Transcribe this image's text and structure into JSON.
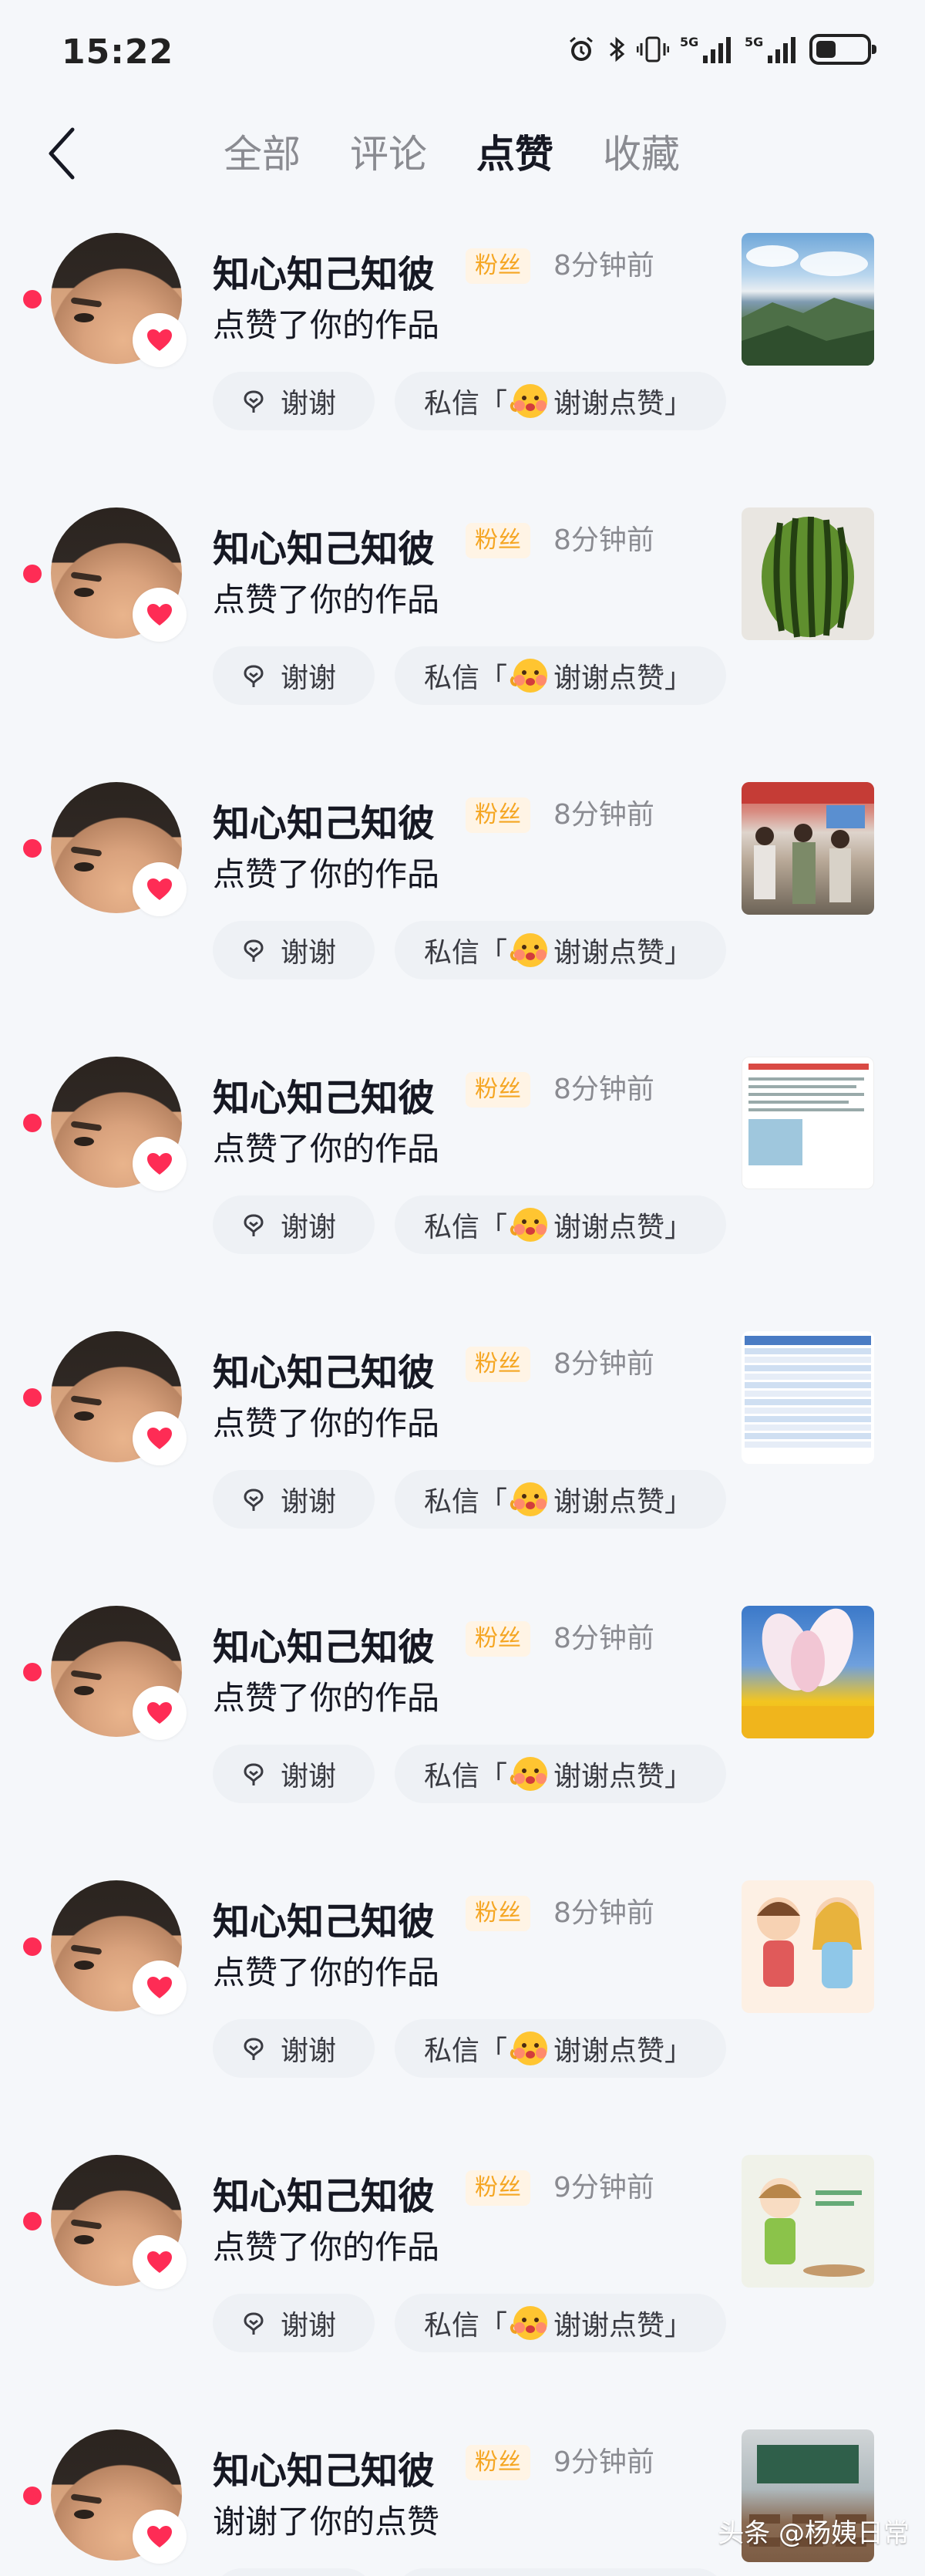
{
  "status": {
    "time": "15:22",
    "network": "5G",
    "battery_level": 0.4
  },
  "nav": {
    "tabs": [
      {
        "label": "全部",
        "active": false
      },
      {
        "label": "评论",
        "active": false
      },
      {
        "label": "点赞",
        "active": true
      },
      {
        "label": "收藏",
        "active": false
      }
    ]
  },
  "labels": {
    "thanks": "谢谢",
    "dm_prefix": "私信「",
    "dm_text": "谢谢点赞」"
  },
  "items": [
    {
      "name": "知心知己知彼",
      "badge": "粉丝",
      "time": "8分钟前",
      "action": "点赞了你的作品",
      "thumb": "mountain-landscape"
    },
    {
      "name": "知心知己知彼",
      "badge": "粉丝",
      "time": "8分钟前",
      "action": "点赞了你的作品",
      "thumb": "watermelon"
    },
    {
      "name": "知心知己知彼",
      "badge": "粉丝",
      "time": "8分钟前",
      "action": "点赞了你的作品",
      "thumb": "crowd-in-room"
    },
    {
      "name": "知心知己知彼",
      "badge": "粉丝",
      "time": "8分钟前",
      "action": "点赞了你的作品",
      "thumb": "text-document"
    },
    {
      "name": "知心知己知彼",
      "badge": "粉丝",
      "time": "8分钟前",
      "action": "点赞了你的作品",
      "thumb": "data-table"
    },
    {
      "name": "知心知己知彼",
      "badge": "粉丝",
      "time": "8分钟前",
      "action": "点赞了你的作品",
      "thumb": "flower"
    },
    {
      "name": "知心知己知彼",
      "badge": "粉丝",
      "time": "8分钟前",
      "action": "点赞了你的作品",
      "thumb": "cartoon-kids"
    },
    {
      "name": "知心知己知彼",
      "badge": "粉丝",
      "time": "9分钟前",
      "action": "点赞了你的作品",
      "thumb": "cartoon-girl"
    },
    {
      "name": "知心知己知彼",
      "badge": "粉丝",
      "time": "9分钟前",
      "action": "谢谢了你的点赞",
      "thumb": "classroom"
    }
  ],
  "watermark": "头条 @杨姨日常",
  "colors": {
    "accent": "#fe2c55",
    "fan_badge": "#f5a623"
  }
}
